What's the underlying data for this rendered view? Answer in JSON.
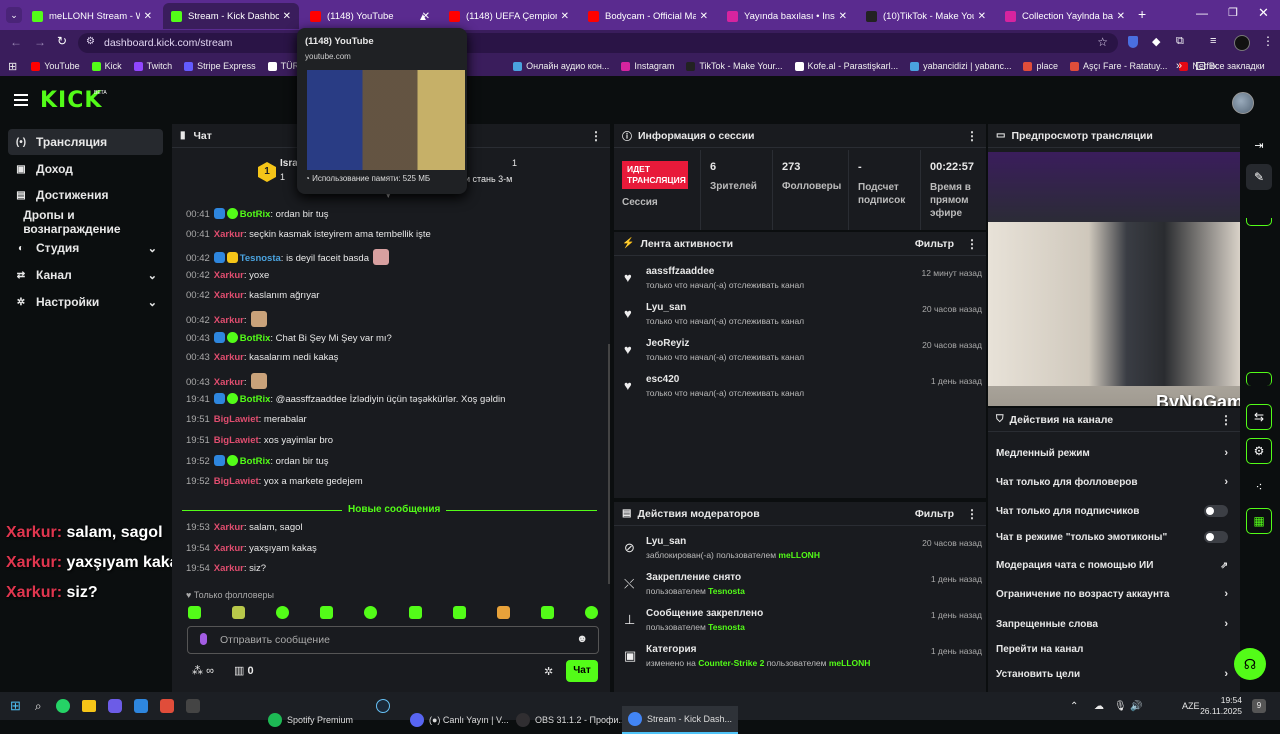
{
  "browser": {
    "tabs": [
      {
        "label": "meLLONH Stream - Watc",
        "color": "#53fc18"
      },
      {
        "label": "Stream - Kick Dashboard",
        "color": "#53fc18"
      },
      {
        "label": "(1148) YouTube",
        "color": "#ff0000"
      },
      {
        "label": "(1148) UEFA Çempionlar l",
        "color": "#ff0000"
      },
      {
        "label": "Bodycam - Official Major",
        "color": "#ff0000"
      },
      {
        "label": "Yayında baxılası • Instagr",
        "color": "#d6249f"
      },
      {
        "label": "(10)TikTok - Make Your D",
        "color": "#222222"
      },
      {
        "label": "Collection Yaylnda baxla",
        "color": "#d6249f"
      }
    ],
    "url": "dashboard.kick.com/stream",
    "tooltip": {
      "title": "(1148) YouTube",
      "domain": "youtube.com",
      "memory": "Использование памяти: 525 МБ"
    },
    "bookmarks": [
      {
        "label": "YouTube",
        "color": "#ff0000"
      },
      {
        "label": "Kick",
        "color": "#53fc18"
      },
      {
        "label": "Twitch",
        "color": "#9146ff"
      },
      {
        "label": "Stripe Express",
        "color": "#635bff"
      },
      {
        "label": "TÜRKA",
        "color": "#ffffff"
      },
      {
        "label": "Онлайн аудио кон...",
        "color": "#4aa3df"
      },
      {
        "label": "Instagram",
        "color": "#d6249f"
      },
      {
        "label": "TikTok - Make Your...",
        "color": "#222222"
      },
      {
        "label": "Kofe.al - Parastişkarl...",
        "color": "#ffffff"
      },
      {
        "label": "yabancidizi | yabanc...",
        "color": "#4aa3df"
      },
      {
        "label": "place",
        "color": "#e04d3a"
      },
      {
        "label": "Aşçı Fare - Ratatuy...",
        "color": "#e04d3a"
      },
      {
        "label": "Netflix",
        "color": "#e50914"
      }
    ],
    "all_bookmarks": "Все закладки"
  },
  "site": {
    "logo": "KICK",
    "logo_beta": "BETA"
  },
  "sidebar": {
    "items": [
      {
        "label": "Трансляция"
      },
      {
        "label": "Доход"
      },
      {
        "label": "Достижения"
      },
      {
        "label": "Дропы и вознаграждение"
      },
      {
        "label": "Студия"
      },
      {
        "label": "Канал"
      },
      {
        "label": "Настройки"
      }
    ]
  },
  "chat": {
    "title": "Чат",
    "pinned_user": "Isra",
    "pinned_count": "1",
    "pinned_text": "ск и стань 3-м",
    "right_count": "1",
    "new_messages": "Новые сообщения",
    "messages": [
      {
        "time": "00:41",
        "user": "BotRix",
        "sep": ":",
        "text": " ordan bir tuş"
      },
      {
        "time": "00:41",
        "user": "Xarkur",
        "sep": ":",
        "text": " seçkin kasmak isteyirem ama tembellik işte"
      },
      {
        "time": "00:42",
        "user": "Tesnosta",
        "sep": ":",
        "text": " is deyil faceit basda"
      },
      {
        "time": "00:42",
        "user": "Xarkur",
        "sep": ":",
        "text": " yoxe"
      },
      {
        "time": "00:42",
        "user": "Xarkur",
        "sep": ":",
        "text": " kaslanım ağrıyar"
      },
      {
        "time": "00:42",
        "user": "Xarkur",
        "sep": ":",
        "text": ""
      },
      {
        "time": "00:43",
        "user": "BotRix",
        "sep": ":",
        "text": " Chat Bi Şey Mi Şey var mı?"
      },
      {
        "time": "00:43",
        "user": "Xarkur",
        "sep": ":",
        "text": " kasalarım nedi kakaş"
      },
      {
        "time": "00:43",
        "user": "Xarkur",
        "sep": ":",
        "text": ""
      },
      {
        "time": "19:41",
        "user": "BotRix",
        "sep": ":",
        "text": " @aassffzaaddee İzlədiyin üçün təşəkkürlər. Xoş gəldin"
      },
      {
        "time": "19:51",
        "user": "BigLawiet",
        "sep": ":",
        "text": " merabalar"
      },
      {
        "time": "19:51",
        "user": "BigLawiet",
        "sep": ":",
        "text": " xos yayimlar bro"
      },
      {
        "time": "19:52",
        "user": "BotRix",
        "sep": ":",
        "text": " ordan bir tuş"
      },
      {
        "time": "19:52",
        "user": "BigLawiet",
        "sep": ":",
        "text": " yox a markete gedejem"
      }
    ],
    "new": [
      {
        "time": "19:53",
        "user": "Xarkur",
        "sep": ":",
        "text": " salam, sagol"
      },
      {
        "time": "19:54",
        "user": "Xarkur",
        "sep": ":",
        "text": " yaxşıyam kakaş"
      },
      {
        "time": "19:54",
        "user": "Xarkur",
        "sep": ":",
        "text": " siz?"
      }
    ],
    "followers_only": "Только фолловеры",
    "input_placeholder": "Отправить сообщение",
    "infinity": "∞",
    "zero": "0",
    "send": "Чат"
  },
  "overlay": [
    {
      "user": "Xarkur:",
      "text": " salam, sagol"
    },
    {
      "user": "Xarkur:",
      "text": " yaxşıyam kakaş"
    },
    {
      "user": "Xarkur:",
      "text": " siz?"
    }
  ],
  "session": {
    "title": "Информация о сессии",
    "live_label": "ИДЕТ\nТРАНСЛЯЦИЯ",
    "session_label": "Сессия",
    "stats": [
      {
        "value": "6",
        "label": "Зрителей"
      },
      {
        "value": "273",
        "label": "Фолловеры"
      },
      {
        "value": "-",
        "label": "Подсчет подписок"
      },
      {
        "value": "00:22:57",
        "label": "Время в прямом эфире"
      }
    ]
  },
  "activity": {
    "title": "Лента активности",
    "filter": "Фильтр",
    "items": [
      {
        "name": "aassffzaaddee",
        "sub": "только что начал(-а) отслеживать канал",
        "time": "12 минут назад"
      },
      {
        "name": "Lyu_san",
        "sub": "только что начал(-а) отслеживать канал",
        "time": "20 часов назад"
      },
      {
        "name": "JeoReyiz",
        "sub": "только что начал(-а) отслеживать канал",
        "time": "20 часов назад"
      },
      {
        "name": "esc420",
        "sub": "только что начал(-а) отслеживать канал",
        "time": "1 день назад"
      }
    ]
  },
  "modactions": {
    "title": "Действия модераторов",
    "filter": "Фильтр",
    "items": [
      {
        "name": "Lyu_san",
        "pre": "заблокирован(-а) пользователем ",
        "hl1": "meLLONH",
        "mid": "",
        "hl2": "",
        "time": "20 часов назад"
      },
      {
        "name": "Закрепление снято",
        "pre": "пользователем ",
        "hl1": "Tesnosta",
        "mid": "",
        "hl2": "",
        "time": "1 день назад"
      },
      {
        "name": "Сообщение закреплено",
        "pre": "пользователем ",
        "hl1": "Tesnosta",
        "mid": "",
        "hl2": "",
        "time": "1 день назад"
      },
      {
        "name": "Категория",
        "pre": "изменено на ",
        "hl1": "Counter-Strike 2",
        "mid": " пользователем ",
        "hl2": "meLLONH",
        "time": "1 день назад"
      }
    ]
  },
  "preview": {
    "title": "Предпросмотр трансляции",
    "watermark": "ByNoGame"
  },
  "channel_actions": {
    "title": "Действия на канале",
    "items": [
      {
        "label": "Медленный режим",
        "type": "chevron"
      },
      {
        "label": "Чат только для фолловеров",
        "type": "chevron"
      },
      {
        "label": "Чат только для подписчиков",
        "type": "toggle"
      },
      {
        "label": "Чат в режиме \"только эмотиконы\"",
        "type": "toggle"
      },
      {
        "label": "Модерация чата с помощью ИИ",
        "type": "external"
      },
      {
        "label": "Ограничение по возрасту аккаунта",
        "type": "chevron"
      },
      {
        "label": "Запрещенные слова",
        "type": "chevron"
      },
      {
        "label": "Перейти на канал",
        "type": "none"
      },
      {
        "label": "Установить цели",
        "type": "chevron"
      }
    ]
  },
  "taskbar": {
    "apps": [
      {
        "label": "Spotify Premium",
        "color": "#1db954"
      },
      {
        "label": "(●) Canlı Yayın | V...",
        "color": "#5865f2"
      },
      {
        "label": "OBS 31.1.2 - Профи...",
        "color": "#302e31"
      },
      {
        "label": "Stream - Kick Dash...",
        "color": "#4285f4"
      }
    ],
    "lang": "AZE",
    "time": "19:54",
    "date": "26.11.2025",
    "notif": "9"
  }
}
